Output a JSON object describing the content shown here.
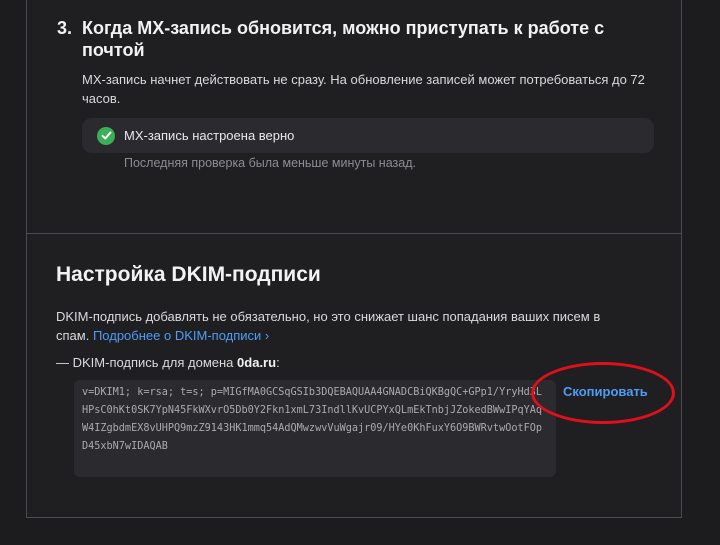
{
  "step3": {
    "number": "3.",
    "title": "Когда MX-запись обновится, можно приступать к работе с почтой",
    "description": "MX-запись начнет действовать не сразу. На обновление записей может потребоваться до 72 часов.",
    "status": "MX-запись настроена верно",
    "last_check": "Последняя проверка была меньше минуты назад."
  },
  "dkim": {
    "title": "Настройка DKIM-подписи",
    "description": "DKIM-подпись добавлять не обязательно, но это снижает шанс попадания ваших писем в спам.",
    "more_link": "Подробнее о DKIM-подписи ›",
    "domain_prefix": "— DKIM-подпись для домена",
    "domain": "0da.ru",
    "domain_suffix": ":",
    "value": "v=DKIM1; k=rsa; t=s; p=MIGfMA0GCSqGSIb3DQEBAQUAA4GNADCBiQKBgQC+GPp1/YryHd3LHPsC0hKt0SK7YpN45FkWXvrO5Db0Y2Fkn1xmL73IndllKvUCPYxQLmEkTnbjJZokedBWwIPqYAqW4IZgbdmEX8vUHPQ9mzZ9143HK1mmq54AdQMwzwvVuWgajr09/HYe0KhFuxY6O9BWRvtwOotFOpD45xbN7wIDAQAB",
    "copy_label": "Скопировать"
  },
  "colors": {
    "accent": "#4f9cf5",
    "success": "#3aaf55",
    "annotation": "#e0101a"
  }
}
